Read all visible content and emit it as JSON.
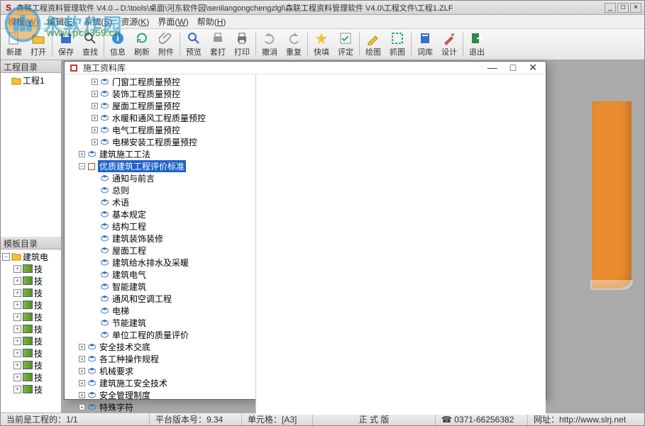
{
  "window": {
    "title": "森联工程资料管理软件 V4.0→D:\\tools\\桌面\\河东软件园\\senliangongchengzlgl\\森联工程资料管理软件 V4.0\\工程文件\\工程1.ZLF"
  },
  "watermark": {
    "text": "永软作园",
    "url": "www.pc0359.cn"
  },
  "menu": [
    {
      "label": "模板",
      "key": "W"
    },
    {
      "label": "编辑",
      "key": "E"
    },
    {
      "label": "系统",
      "key": "S"
    },
    {
      "label": "资源",
      "key": "K"
    },
    {
      "label": "界面",
      "key": "W"
    },
    {
      "label": "帮助",
      "key": "H"
    }
  ],
  "toolbar": [
    {
      "id": "new",
      "label": "新建"
    },
    {
      "id": "open",
      "label": "打开"
    },
    {
      "sep": true
    },
    {
      "id": "save",
      "label": "保存"
    },
    {
      "id": "find",
      "label": "查找"
    },
    {
      "sep": true
    },
    {
      "id": "info",
      "label": "信息"
    },
    {
      "id": "refresh",
      "label": "刷新"
    },
    {
      "id": "attach",
      "label": "附件"
    },
    {
      "sep": true
    },
    {
      "id": "preview",
      "label": "预览"
    },
    {
      "id": "print-set",
      "label": "套打"
    },
    {
      "id": "print",
      "label": "打印"
    },
    {
      "sep": true
    },
    {
      "id": "undo",
      "label": "撤消"
    },
    {
      "id": "redo",
      "label": "重复"
    },
    {
      "sep": true
    },
    {
      "id": "quickfill",
      "label": "快填"
    },
    {
      "id": "eval",
      "label": "评定"
    },
    {
      "sep": true
    },
    {
      "id": "draw",
      "label": "绘图"
    },
    {
      "id": "capture",
      "label": "抓图"
    },
    {
      "sep": true
    },
    {
      "id": "dict",
      "label": "词库"
    },
    {
      "id": "design",
      "label": "设计"
    },
    {
      "sep": true
    },
    {
      "id": "exit",
      "label": "退出"
    }
  ],
  "left": {
    "project_header": "工程目录",
    "project_root": "工程1",
    "template_header": "模板目录",
    "template_root": "建筑电",
    "template_items": [
      "技",
      "技",
      "技",
      "技",
      "技",
      "技",
      "技",
      "技",
      "技",
      "技",
      "技"
    ]
  },
  "modal": {
    "title": "施工资料库",
    "tree": [
      {
        "d": 1,
        "exp": "+",
        "icon": "doc",
        "label": "门窗工程质量预控"
      },
      {
        "d": 1,
        "exp": "+",
        "icon": "doc",
        "label": "装饰工程质量预控"
      },
      {
        "d": 1,
        "exp": "+",
        "icon": "doc",
        "label": "屋面工程质量预控"
      },
      {
        "d": 1,
        "exp": "+",
        "icon": "doc",
        "label": "水暖和通风工程质量预控"
      },
      {
        "d": 1,
        "exp": "+",
        "icon": "doc",
        "label": "电气工程质量预控"
      },
      {
        "d": 1,
        "exp": "+",
        "icon": "doc",
        "label": "电梯安装工程质量预控"
      },
      {
        "d": 0,
        "exp": "+",
        "icon": "doc",
        "label": "建筑施工工法"
      },
      {
        "d": 0,
        "exp": "-",
        "icon": "book",
        "label": "优质建筑工程评价标准",
        "selected": true
      },
      {
        "d": 1,
        "exp": "",
        "icon": "doc",
        "label": "通知与前言"
      },
      {
        "d": 1,
        "exp": "",
        "icon": "doc",
        "label": "总则"
      },
      {
        "d": 1,
        "exp": "",
        "icon": "doc",
        "label": "术语"
      },
      {
        "d": 1,
        "exp": "",
        "icon": "doc",
        "label": "基本规定"
      },
      {
        "d": 1,
        "exp": "",
        "icon": "doc",
        "label": "结构工程"
      },
      {
        "d": 1,
        "exp": "",
        "icon": "doc",
        "label": "建筑装饰装修"
      },
      {
        "d": 1,
        "exp": "",
        "icon": "doc",
        "label": "屋面工程"
      },
      {
        "d": 1,
        "exp": "",
        "icon": "doc",
        "label": "建筑给水排水及采暖"
      },
      {
        "d": 1,
        "exp": "",
        "icon": "doc",
        "label": "建筑电气"
      },
      {
        "d": 1,
        "exp": "",
        "icon": "doc",
        "label": "智能建筑"
      },
      {
        "d": 1,
        "exp": "",
        "icon": "doc",
        "label": "通风和空调工程"
      },
      {
        "d": 1,
        "exp": "",
        "icon": "doc",
        "label": "电梯"
      },
      {
        "d": 1,
        "exp": "",
        "icon": "doc",
        "label": "节能建筑"
      },
      {
        "d": 1,
        "exp": "",
        "icon": "doc",
        "label": "单位工程的质量评价"
      },
      {
        "d": 0,
        "exp": "+",
        "icon": "doc",
        "label": "安全技术交底"
      },
      {
        "d": 0,
        "exp": "+",
        "icon": "doc",
        "label": "各工种操作规程"
      },
      {
        "d": 0,
        "exp": "+",
        "icon": "doc",
        "label": "机械要求"
      },
      {
        "d": 0,
        "exp": "+",
        "icon": "doc",
        "label": "建筑施工安全技术"
      },
      {
        "d": 0,
        "exp": "+",
        "icon": "doc",
        "label": "安全管理制度"
      },
      {
        "d": 0,
        "exp": "+",
        "icon": "doc",
        "label": "特殊字符"
      }
    ]
  },
  "status": {
    "current": "当前是工程的：1/1",
    "version": "平台版本号：9.34",
    "cell": "单元格：[A3]",
    "mode": "正 式 版",
    "phone": "☎ 0371-66256382",
    "site": "网址：http://www.slrj.net"
  }
}
